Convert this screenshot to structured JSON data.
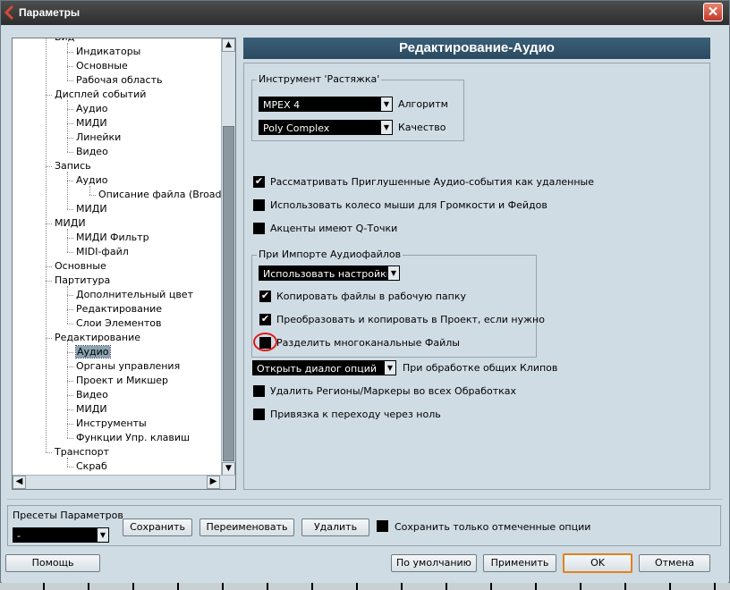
{
  "window": {
    "title": "Параметры",
    "close_label": "✕"
  },
  "tree": {
    "items": [
      {
        "label": "Вид",
        "level": 0
      },
      {
        "label": "Индикаторы",
        "level": 1
      },
      {
        "label": "Основные",
        "level": 1
      },
      {
        "label": "Рабочая область",
        "level": 1
      },
      {
        "label": "Дисплей событий",
        "level": 0
      },
      {
        "label": "Аудио",
        "level": 1
      },
      {
        "label": "МИДИ",
        "level": 1
      },
      {
        "label": "Линейки",
        "level": 1
      },
      {
        "label": "Видео",
        "level": 1
      },
      {
        "label": "Запись",
        "level": 0
      },
      {
        "label": "Аудио",
        "level": 1
      },
      {
        "label": "Описание файла (Broadcast)",
        "level": 2
      },
      {
        "label": "МИДИ",
        "level": 1
      },
      {
        "label": "МИДИ",
        "level": 0
      },
      {
        "label": "МИДИ Фильтр",
        "level": 1
      },
      {
        "label": "MIDI-файл",
        "level": 1
      },
      {
        "label": "Основные",
        "level": 0
      },
      {
        "label": "Партитура",
        "level": 0
      },
      {
        "label": "Дополнительный цвет",
        "level": 1
      },
      {
        "label": "Редактирование",
        "level": 1
      },
      {
        "label": "Слои Элементов",
        "level": 1
      },
      {
        "label": "Редактирование",
        "level": 0
      },
      {
        "label": "Аудио",
        "level": 1,
        "selected": true
      },
      {
        "label": "Органы управления",
        "level": 1
      },
      {
        "label": "Проект и Микшер",
        "level": 1
      },
      {
        "label": "Видео",
        "level": 1
      },
      {
        "label": "МИДИ",
        "level": 1
      },
      {
        "label": "Инструменты",
        "level": 1
      },
      {
        "label": "Функции Упр. клавиш",
        "level": 1
      },
      {
        "label": "Транспорт",
        "level": 0
      },
      {
        "label": "Скраб",
        "level": 1
      }
    ]
  },
  "panel": {
    "title": "Редактирование-Аудио",
    "stretch_group": {
      "legend": "Инструмент 'Растяжка'",
      "algorithm_value": "MPEX 4",
      "algorithm_label": "Алгоритм",
      "quality_value": "Poly Complex",
      "quality_label": "Качество"
    },
    "options": {
      "treat_muted": "Рассматривать Приглушенные Аудио-события как удаленные",
      "mouse_wheel": "Использовать колесо мыши для Громкости и Фейдов",
      "hitpoints": "Акценты имеют Q-Точки"
    },
    "import_group": {
      "legend": "При Импорте Аудиофайлов",
      "mode_value": "Использовать настройки",
      "copy_files": "Копировать файлы в рабочую папку",
      "convert_copy": "Преобразовать и копировать в Проект, если нужно",
      "split_multichannel": "Разделить многоканальные Файлы"
    },
    "clip_processing": {
      "value": "Открыть диалог опций",
      "label": "При обработке общих Клипов"
    },
    "remove_regions": "Удалить Регионы/Маркеры во всех Обработках",
    "snap_zero": "Привязка к переходу через ноль",
    "checkbox_states": {
      "treat_muted": true,
      "mouse_wheel": false,
      "hitpoints": false,
      "copy_files": true,
      "convert_copy": true,
      "split_multichannel": false,
      "remove_regions": false,
      "snap_zero": false,
      "save_marked_only": false
    }
  },
  "presets": {
    "label": "Пресеты Параметров",
    "value": "-",
    "save": "Сохранить",
    "rename": "Переименовать",
    "delete": "Удалить",
    "save_marked_only": "Сохранить только отмеченные опции"
  },
  "footer": {
    "help": "Помощь",
    "defaults": "По умолчанию",
    "apply": "Применить",
    "ok": "OK",
    "cancel": "Отмена"
  },
  "icons": {
    "check": "✔",
    "dropdown": "▼",
    "scroll_up": "▲",
    "scroll_down": "▼",
    "scroll_left": "◀",
    "scroll_right": "▶"
  },
  "colors": {
    "title_bg": "#3b5f78",
    "highlight": "#e01818",
    "default_button_border": "#e0821c"
  }
}
